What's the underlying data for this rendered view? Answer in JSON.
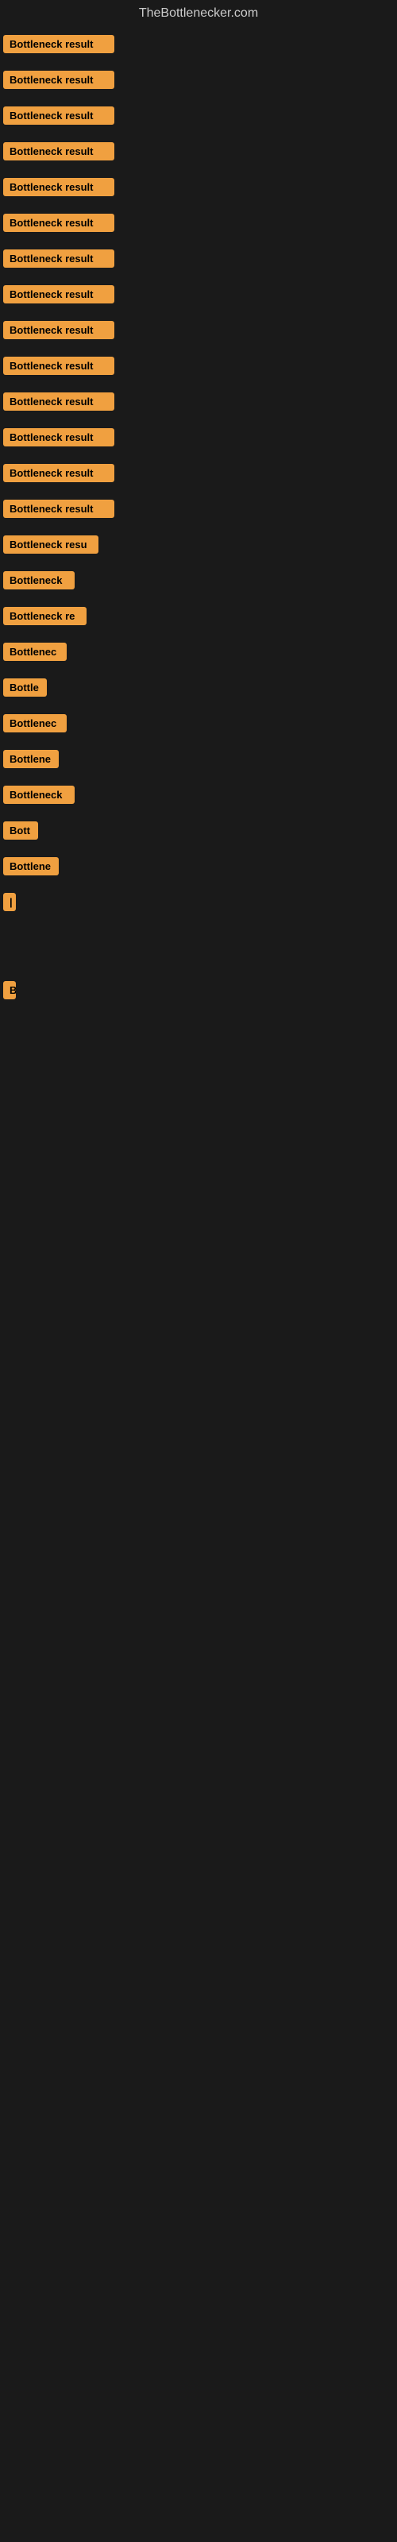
{
  "site": {
    "title": "TheBottlenecker.com"
  },
  "items": [
    {
      "label": "Bottleneck result",
      "width": 140
    },
    {
      "label": "Bottleneck result",
      "width": 140
    },
    {
      "label": "Bottleneck result",
      "width": 140
    },
    {
      "label": "Bottleneck result",
      "width": 140
    },
    {
      "label": "Bottleneck result",
      "width": 140
    },
    {
      "label": "Bottleneck result",
      "width": 140
    },
    {
      "label": "Bottleneck result",
      "width": 140
    },
    {
      "label": "Bottleneck result",
      "width": 140
    },
    {
      "label": "Bottleneck result",
      "width": 140
    },
    {
      "label": "Bottleneck result",
      "width": 140
    },
    {
      "label": "Bottleneck result",
      "width": 140
    },
    {
      "label": "Bottleneck result",
      "width": 140
    },
    {
      "label": "Bottleneck result",
      "width": 140
    },
    {
      "label": "Bottleneck result",
      "width": 140
    },
    {
      "label": "Bottleneck resu",
      "width": 120
    },
    {
      "label": "Bottleneck",
      "width": 90
    },
    {
      "label": "Bottleneck re",
      "width": 105
    },
    {
      "label": "Bottlenec",
      "width": 80
    },
    {
      "label": "Bottle",
      "width": 55
    },
    {
      "label": "Bottlenec",
      "width": 80
    },
    {
      "label": "Bottlene",
      "width": 70
    },
    {
      "label": "Bottleneck",
      "width": 90
    },
    {
      "label": "Bott",
      "width": 44
    },
    {
      "label": "Bottlene",
      "width": 70
    },
    {
      "label": "|",
      "width": 10
    },
    {
      "label": "",
      "width": 0
    },
    {
      "label": "",
      "width": 0
    },
    {
      "label": "",
      "width": 0
    },
    {
      "label": "B",
      "width": 14
    },
    {
      "label": "",
      "width": 0
    },
    {
      "label": "",
      "width": 0
    },
    {
      "label": "",
      "width": 0
    },
    {
      "label": "",
      "width": 0
    },
    {
      "label": "",
      "width": 0
    },
    {
      "label": "",
      "width": 0
    }
  ]
}
